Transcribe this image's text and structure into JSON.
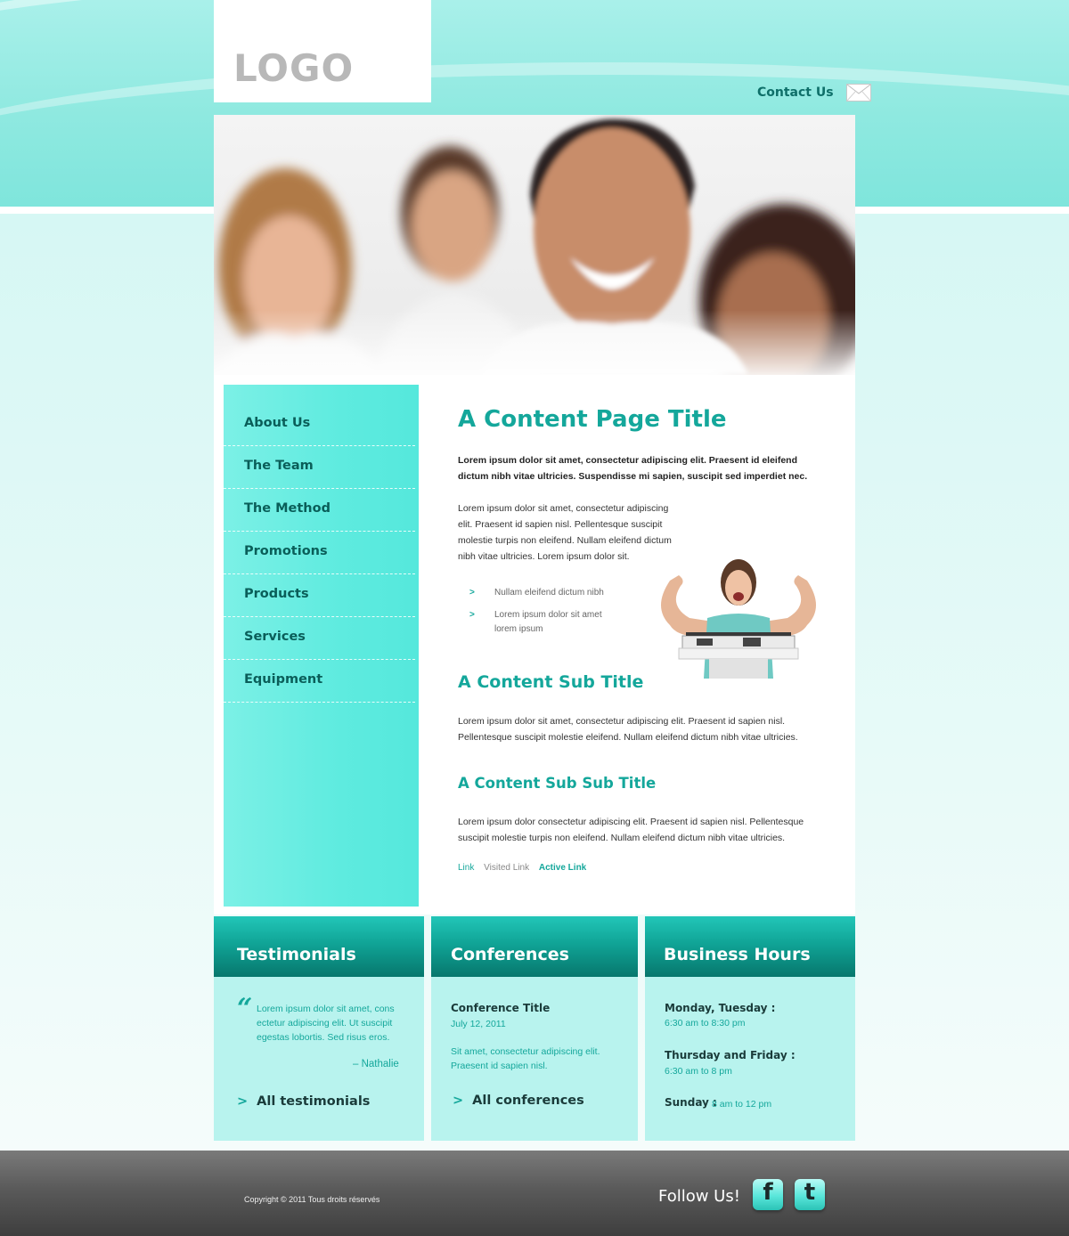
{
  "header": {
    "logo": "LOGO",
    "contact": "Contact Us"
  },
  "nav": [
    {
      "label": "About Us"
    },
    {
      "label": "The Team"
    },
    {
      "label": "The Method"
    },
    {
      "label": "Promotions"
    },
    {
      "label": "Products"
    },
    {
      "label": "Services"
    },
    {
      "label": "Equipment"
    }
  ],
  "content": {
    "title": "A Content Page Title",
    "lead": "Lorem ipsum dolor sit amet, consectetur adipiscing elit. Praesent id eleifend dictum nibh vitae ultricies. Suspendisse mi sapien, suscipit sed imperdiet nec.",
    "paragraph": "Lorem ipsum dolor sit amet, consectetur adipiscing elit. Praesent id sapien nisl. Pellentesque suscipit molestie turpis non eleifend. Nullam eleifend dictum nibh vitae ultricies. Lorem ipsum dolor sit.",
    "bullets": [
      "Nullam eleifend dictum nibh",
      "Lorem ipsum dolor sit amet lorem ipsum"
    ],
    "bullet_marker": ">",
    "subtitle": "A Content Sub Title",
    "sub_paragraph": "Lorem ipsum dolor sit amet, consectetur adipiscing elit. Praesent id sapien nisl. Pellentesque suscipit molestie eleifend. Nullam eleifend dictum nibh vitae ultricies.",
    "subsubtitle": "A Content Sub Sub Title",
    "subsub_paragraph": "Lorem ipsum dolor consectetur adipiscing elit. Praesent id sapien nisl. Pellentesque suscipit molestie turpis non eleifend. Nullam eleifend dictum nibh vitae ultricies.",
    "links": {
      "normal": "Link",
      "visited": "Visited Link",
      "active": "Active Link"
    }
  },
  "testimonials": {
    "title": "Testimonials",
    "quote_mark": "“",
    "quote": "Lorem ipsum dolor sit amet, cons ectetur adipiscing elit. Ut suscipit egestas lobortis. Sed risus eros.",
    "author": "– Nathalie",
    "link": "All testimonials"
  },
  "conferences": {
    "title": "Conferences",
    "conf_title": "Conference Title",
    "date": "July 12, 2011",
    "text": "Sit amet, consectetur adipiscing elit. Praesent id sapien nisl.",
    "link": "All conferences"
  },
  "hours": {
    "title": "Business Hours",
    "rows": [
      {
        "days": "Monday, Tuesday :",
        "time": "6:30 am to 8:30 pm"
      },
      {
        "days": "Thursday and Friday :",
        "time": "6:30 am to 8 pm"
      },
      {
        "days": "Sunday :",
        "time": "8 am to 12 pm"
      }
    ]
  },
  "footer": {
    "copyright": "Copyright © 2011 Tous droits réservés",
    "follow": "Follow Us!",
    "facebook": "f",
    "twitter": "t"
  },
  "colors": {
    "accent": "#14a79b",
    "nav_bg": "#5eebdf",
    "box_bg": "#b8f3ee",
    "footer_bg": "#5a5a5a"
  },
  "icons": {
    "contact": "envelope-icon",
    "facebook": "facebook-icon",
    "twitter": "twitter-icon",
    "arrow": "chevron-right-icon"
  }
}
